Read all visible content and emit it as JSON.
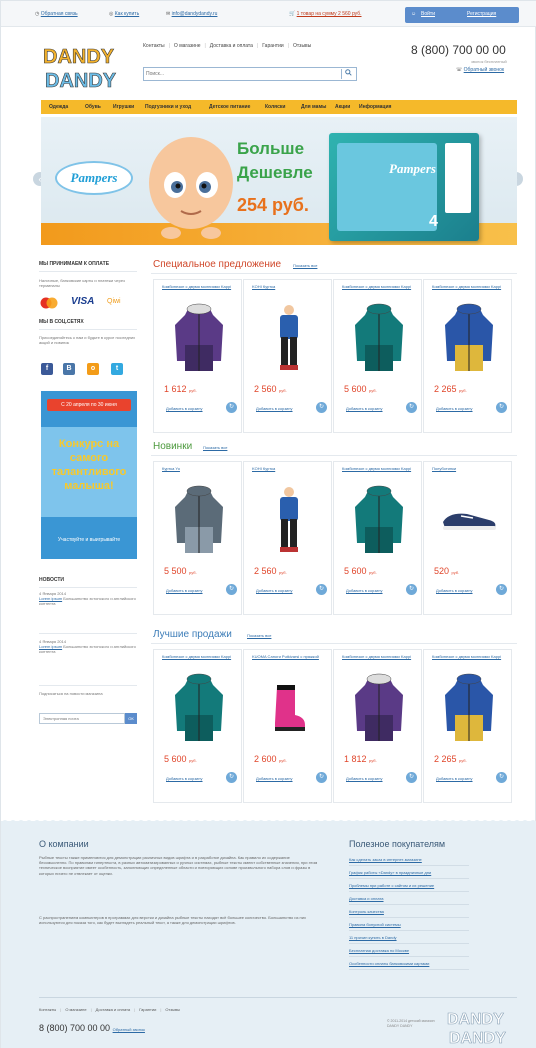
{
  "topbar": {
    "feedback": "Обратная связь",
    "how_to_order": "Как купить",
    "email": "info@dandydandy.ru",
    "cart_text": "1 товар на сумму 2 560 руб.",
    "login": "Войти",
    "register": "Регистрация"
  },
  "header": {
    "logo_line1": "DANDY",
    "logo_line2": "DANDY",
    "nav": [
      "Контакты",
      "О магазине",
      "Доставка и оплата",
      "Гарантии",
      "Отзывы"
    ],
    "phone": "8 (800) 700 00 00",
    "phone_note": "звонок бесплатный",
    "callback": "Обратный звонок",
    "search_placeholder": "Поиск...",
    "search_icon": "magnifier-icon"
  },
  "categories": [
    "Одежда",
    "Обувь",
    "Игрушки",
    "Подгузники и уход",
    "Детское питание",
    "Коляски",
    "Для мамы",
    "Акции",
    "Информация"
  ],
  "banner": {
    "brand": "Pampers",
    "line1": "Больше",
    "line2": "Дешевле",
    "price": "254 руб.",
    "pack_number": "4"
  },
  "sidebar": {
    "payment_title": "МЫ ПРИНИМАЕМ К ОПЛАТЕ",
    "payment_text": "Наличные, банковские карты и платежи через терминалы",
    "payment_logos": [
      "mastercard-icon",
      "VISA",
      "Qiwi"
    ],
    "social_title": "МЫ В СОЦ.СЕТЯХ",
    "social_text": "Присоединяйтесь к нам и будьте в курсе последних акций и новинок",
    "social_icons": [
      "f",
      "В",
      "о",
      "t"
    ],
    "promo_date": "С 20 апреля по 30 июня",
    "promo_text": "Конкурс на самого талантливого малыша!",
    "promo_footer": "Участвуйте и выигрывайте",
    "news_title": "НОВОСТИ",
    "news": [
      {
        "date": "4 Января 2014",
        "title": "Lorem ipsum",
        "text": "Большинство эстонского и английского контента"
      },
      {
        "date": "4 Января 2014",
        "title": "Lorem ipsum",
        "text": "Большинство эстонского и английского контента"
      }
    ],
    "subscribe_text": "Подписаться на новости магазина",
    "subscribe_placeholder": "Электронная почта",
    "subscribe_button": "ОК"
  },
  "sections": [
    {
      "title": "Специальное предложение",
      "link": "Показать все",
      "items": [
        {
          "name": "Комбинезон с двумя молниями Kappi",
          "price": "1 612",
          "currency": "руб.",
          "cart": "Добавить в корзину",
          "image": "purple-jacket"
        },
        {
          "name": "KOHI Куртка",
          "price": "2 560",
          "currency": "руб.",
          "cart": "Добавить в корзину",
          "image": "boy-suit"
        },
        {
          "name": "Комбинезон с двумя молниями Kappi",
          "price": "5 600",
          "currency": "руб.",
          "cart": "Добавить в корзину",
          "image": "teal-jacket"
        },
        {
          "name": "Комбинезон с двумя молниями Kappi",
          "price": "2 265",
          "currency": "руб.",
          "cart": "Добавить в корзину",
          "image": "blue-yellow-jacket"
        }
      ]
    },
    {
      "title": "Новинки",
      "link": "Показать все",
      "items": [
        {
          "name": "Куртка Yo",
          "price": "5 500",
          "currency": "руб.",
          "cart": "Добавить в корзину",
          "image": "plaid-jacket"
        },
        {
          "name": "KOHI Куртка",
          "price": "2 560",
          "currency": "руб.",
          "cart": "Добавить в корзину",
          "image": "boy-suit"
        },
        {
          "name": "Комбинезон с двумя молниями Kappi",
          "price": "5 600",
          "currency": "руб.",
          "cart": "Добавить в корзину",
          "image": "teal-jacket"
        },
        {
          "name": "Полуботинки",
          "price": "520",
          "currency": "руб.",
          "cart": "Добавить в корзину",
          "image": "sneaker"
        }
      ]
    },
    {
      "title": "Лучшие продажи",
      "link": "Показать все",
      "items": [
        {
          "name": "Комбинезон с двумя молниями Kappi",
          "price": "5 600",
          "currency": "руб.",
          "cart": "Добавить в корзину",
          "image": "teal-jacket"
        },
        {
          "name": "KUOMA Сапоги Putkivarsi с пряжкой",
          "price": "2 600",
          "currency": "руб.",
          "cart": "Добавить в корзину",
          "image": "pink-boot"
        },
        {
          "name": "Комбинезон с двумя молниями Kappi",
          "price": "1 812",
          "currency": "руб.",
          "cart": "Добавить в корзину",
          "image": "purple-jacket"
        },
        {
          "name": "Комбинезон с двумя молниями Kappi",
          "price": "2 265",
          "currency": "руб.",
          "cart": "Добавить в корзину",
          "image": "blue-yellow-jacket"
        }
      ]
    }
  ],
  "footer": {
    "about_title": "О компании",
    "about_p1": "Рыбные тексты также применяются для демонстрации различных видов шрифта и в разработке дизайна. Как правило их содержание бессмысленно. По правилам гипертекста, в разных автоматизированных и ручных системах, рыбные тексты имеют собственные значения, при этом техническое восприятие имеет особенность, заполняющих определенные области и повторяющих основе произвольного набора слов и фразы в которых ничего не отвлекает от оценки.",
    "about_p2": "С распространением компьютеров в программах для верстки и дизайна рыбные тексты находят всё большее количество. Большинство из них используются для показа того, как будет выглядеть реальный текст, а также для демонстрации шрифтов.",
    "useful_title": "Полезное покупателям",
    "useful_links": [
      "Как сделать заказ в интернет-магазине",
      "График работы «Dandy» в праздничные дни",
      "Проблемы при работе с сайтом и их решение",
      "Доставка и оплата",
      "Контроль качества",
      "Правила бонусной системы",
      "11 причин купить в Dandy",
      "Бесплатная доставка по Москве",
      "Особенности оплаты банковскими картами"
    ],
    "nav": [
      "Контакты",
      "О магазине",
      "Доставка и оплата",
      "Гарантии",
      "Отзывы"
    ],
    "phone": "8 (800) 700 00 00",
    "callback": "Обратный звонок",
    "copyright": "© 2011-2014 детский магазин DANDY DANDY",
    "logo_line1": "DANDY",
    "logo_line2": "DANDY"
  },
  "colors": {
    "accent_orange": "#f5b92a",
    "price_red": "#e0452a",
    "link_blue": "#2c6aa5",
    "login_blue": "#5b8ccc"
  }
}
